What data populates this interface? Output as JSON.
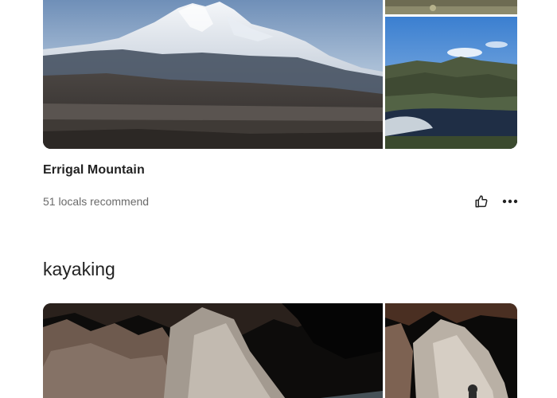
{
  "places": [
    {
      "title": "Errigal Mountain",
      "subtitle": "51 locals recommend",
      "photos": {
        "main": "errigal-mountain-photo",
        "side_top": "landscape-photo",
        "side_bottom": "lake-hills-photo"
      }
    }
  ],
  "section": {
    "title": "kayaking",
    "photos": {
      "main": "sea-cave-photo",
      "side": "sea-cave-photo"
    }
  },
  "icons": {
    "like": "thumbs-up-icon",
    "more": "more-options-icon"
  },
  "colors": {
    "text_primary": "#222222",
    "text_secondary": "#6a6a6a",
    "background": "#ffffff"
  }
}
